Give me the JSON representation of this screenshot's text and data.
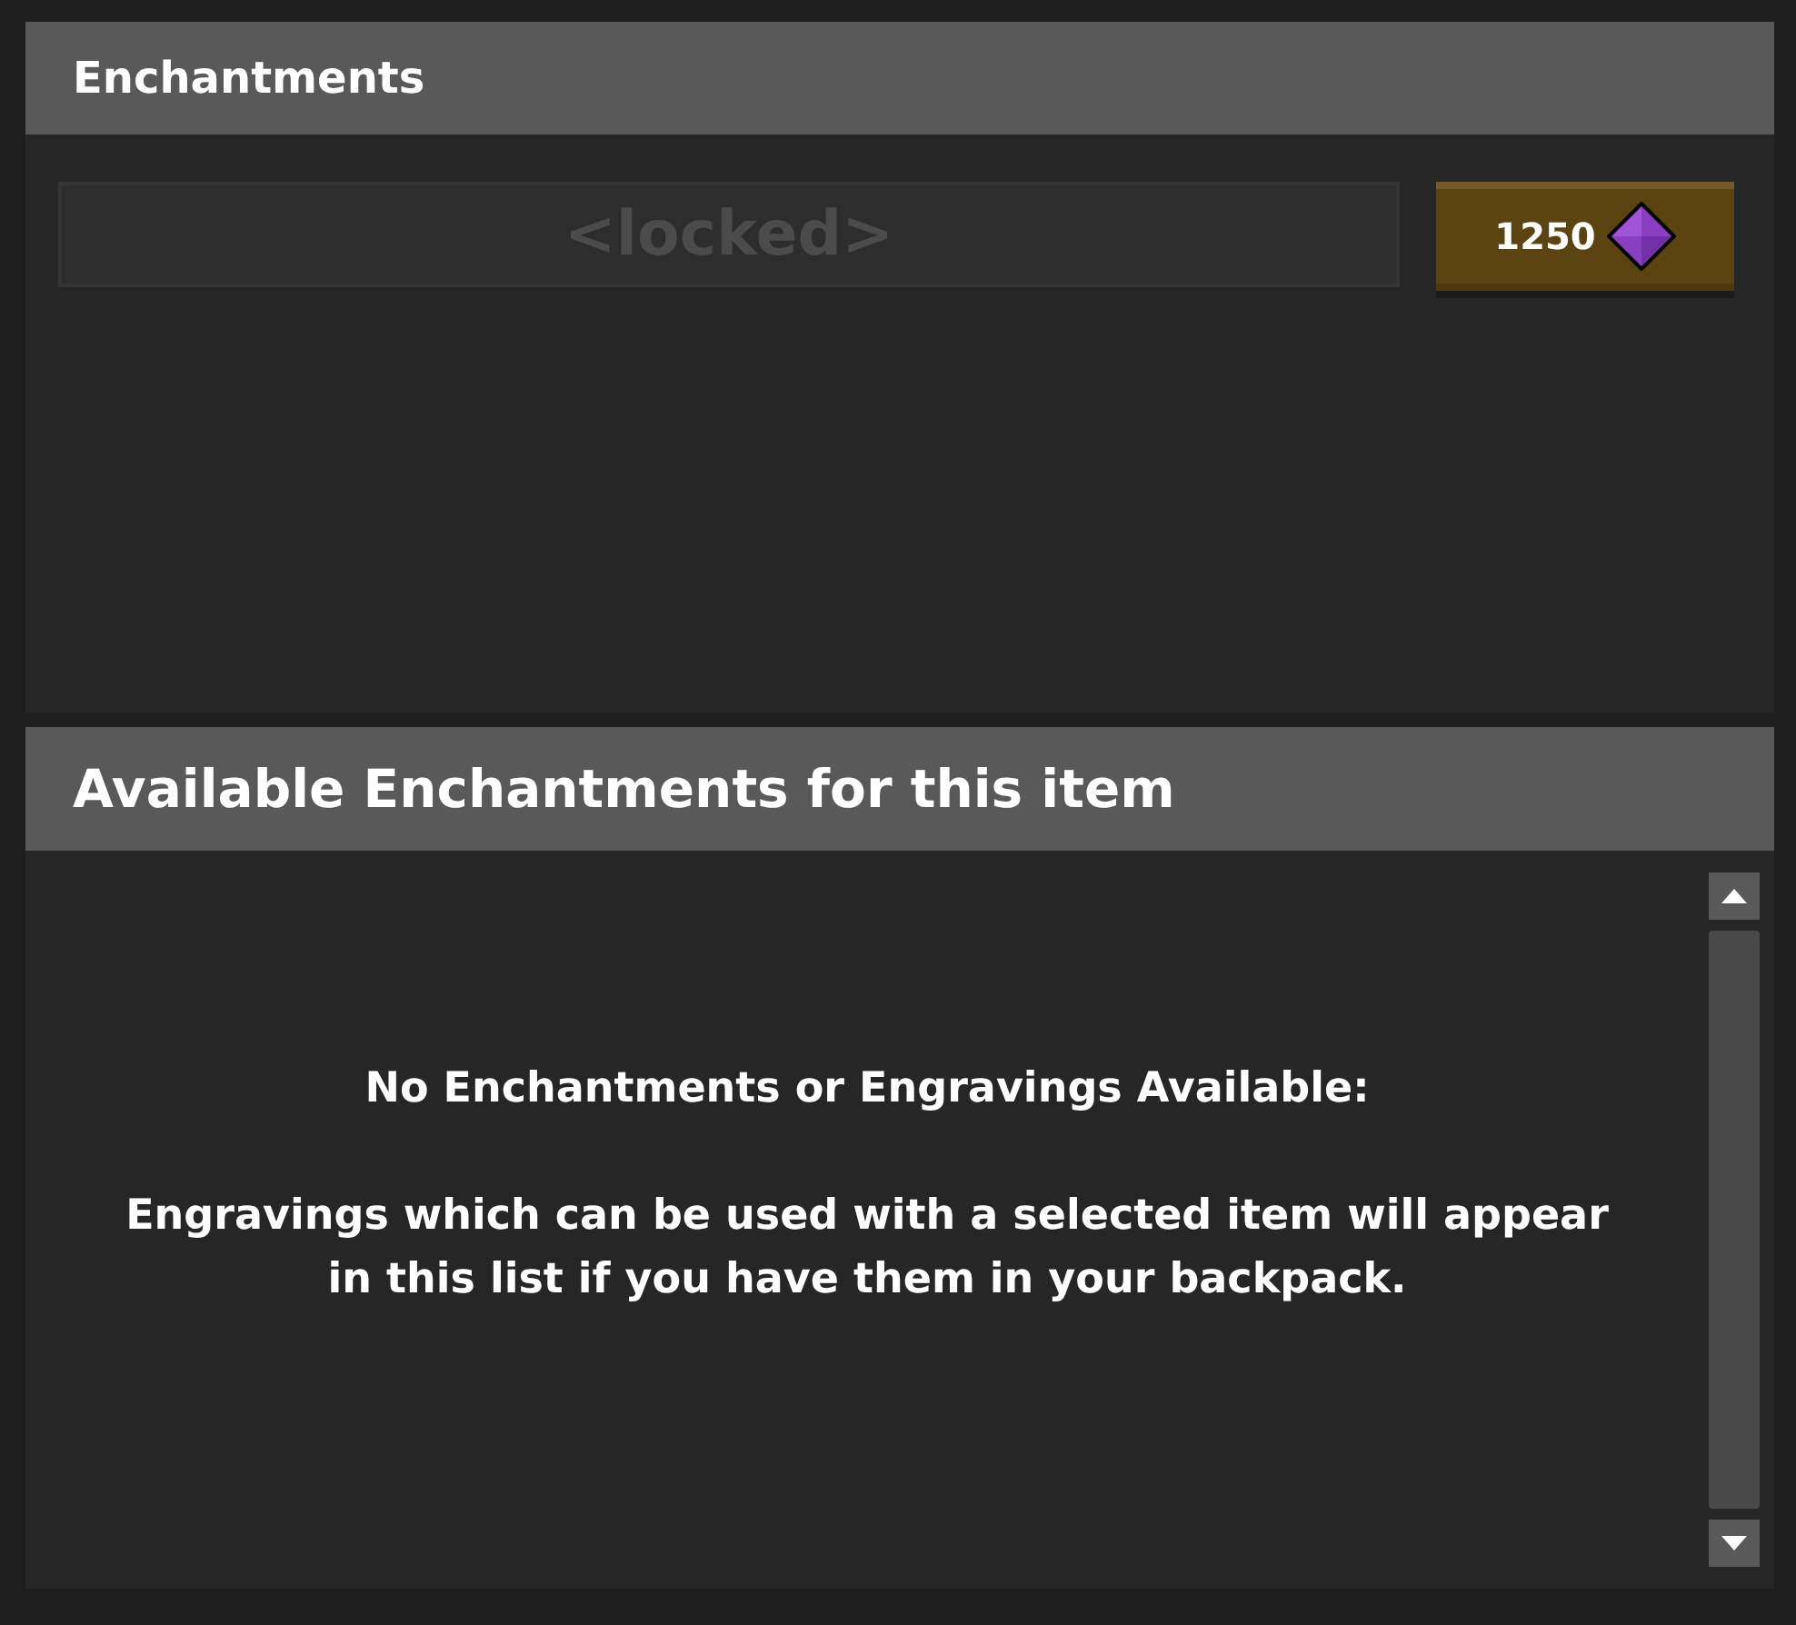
{
  "enchantments_panel": {
    "title": "Enchantments",
    "slot": {
      "label": "<locked>",
      "disabled": true
    },
    "cost": {
      "amount": "1250"
    }
  },
  "available_panel": {
    "title": "Available Enchantments for this item",
    "empty_message": {
      "heading": "No Enchantments or Engravings Available:",
      "body": "Engravings which can be used with a selected item will appear in this list if you have them in your backpack."
    }
  }
}
